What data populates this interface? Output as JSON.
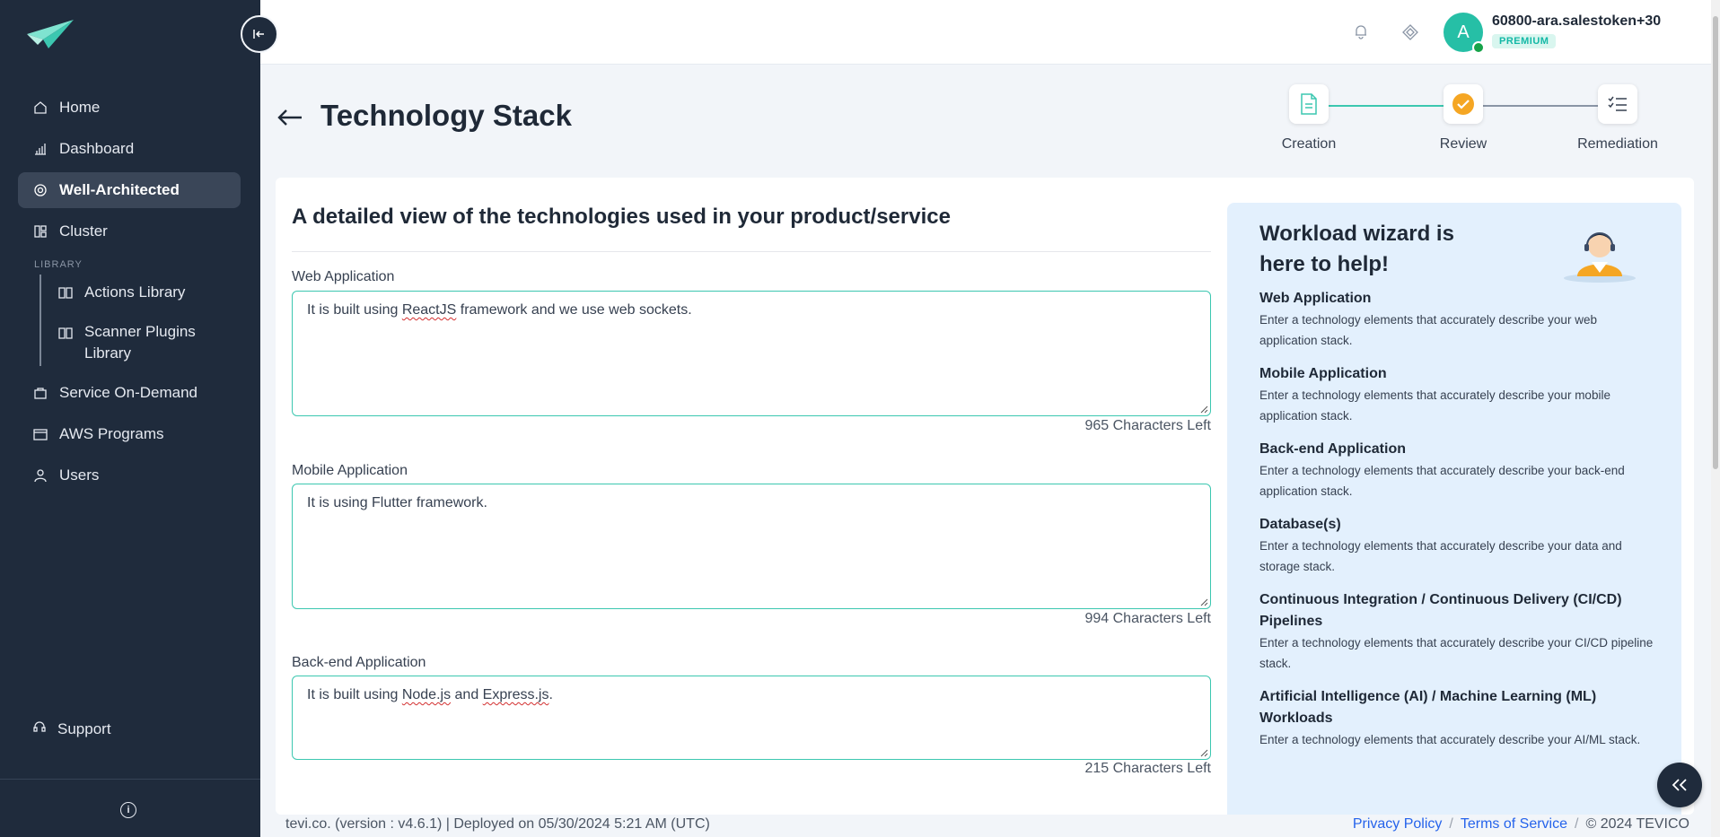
{
  "sidebar": {
    "items": [
      {
        "label": "Home",
        "icon": "home-icon"
      },
      {
        "label": "Dashboard",
        "icon": "bar-chart-icon"
      },
      {
        "label": "Well-Architected",
        "icon": "gear-icon",
        "active": true
      },
      {
        "label": "Cluster",
        "icon": "cluster-icon"
      }
    ],
    "section_label": "LIBRARY",
    "library_items": [
      {
        "label": "Actions Library",
        "icon": "book-icon"
      },
      {
        "label": "Scanner Plugins Library",
        "icon": "book-icon"
      }
    ],
    "bottom_items": [
      {
        "label": "Service On-Demand",
        "icon": "bag-icon"
      },
      {
        "label": "AWS Programs",
        "icon": "folder-icon"
      },
      {
        "label": "Users",
        "icon": "user-icon"
      }
    ],
    "support_label": "Support"
  },
  "header": {
    "username": "60800-ara.salestoken+30",
    "avatar_letter": "A",
    "badge": "PREMIUM"
  },
  "page": {
    "title": "Technology Stack",
    "steps": [
      {
        "label": "Creation",
        "state": "done"
      },
      {
        "label": "Review",
        "state": "current"
      },
      {
        "label": "Remediation",
        "state": "pending"
      }
    ]
  },
  "form": {
    "heading": "A detailed view of the technologies used in your product/service",
    "fields": [
      {
        "label": "Web Application",
        "value_parts": [
          "It is built using ",
          "ReactJS",
          " framework and we use web sockets."
        ],
        "chars_left": "965 Characters Left"
      },
      {
        "label": "Mobile Application",
        "value": "It is using Flutter framework.",
        "chars_left": "994 Characters Left"
      },
      {
        "label": "Back-end Application",
        "value_parts": [
          "It is built using ",
          "Node.js",
          " and ",
          "Express.js",
          "."
        ],
        "chars_left": "215 Characters Left"
      }
    ]
  },
  "help": {
    "title": "Workload wizard is here to help!",
    "items": [
      {
        "heading": "Web Application",
        "text": "Enter a technology elements that accurately describe your web application stack."
      },
      {
        "heading": "Mobile Application",
        "text": "Enter a technology elements that accurately describe your mobile application stack."
      },
      {
        "heading": "Back-end Application",
        "text": "Enter a technology elements that accurately describe your back-end application stack."
      },
      {
        "heading": "Database(s)",
        "text": "Enter a technology elements that accurately describe your data and storage stack."
      },
      {
        "heading": "Continuous Integration / Continuous Delivery (CI/CD) Pipelines",
        "text": "Enter a technology elements that accurately describe your CI/CD pipeline stack."
      },
      {
        "heading": "Artificial Intelligence (AI) / Machine Learning (ML) Workloads",
        "text": "Enter a technology elements that accurately describe your AI/ML stack."
      }
    ]
  },
  "footer": {
    "left": "tevi.co. (version : v4.6.1) | Deployed on 05/30/2024 5:21 AM (UTC)",
    "privacy": "Privacy Policy",
    "terms": "Terms of Service",
    "separator": "/",
    "copyright": "© 2024 TEVICO"
  },
  "colors": {
    "sidebar_bg": "#1f2b3c",
    "accent": "#26bfa6",
    "step_current": "#f5a623",
    "help_bg": "#e3f0fd",
    "link": "#2563eb"
  }
}
